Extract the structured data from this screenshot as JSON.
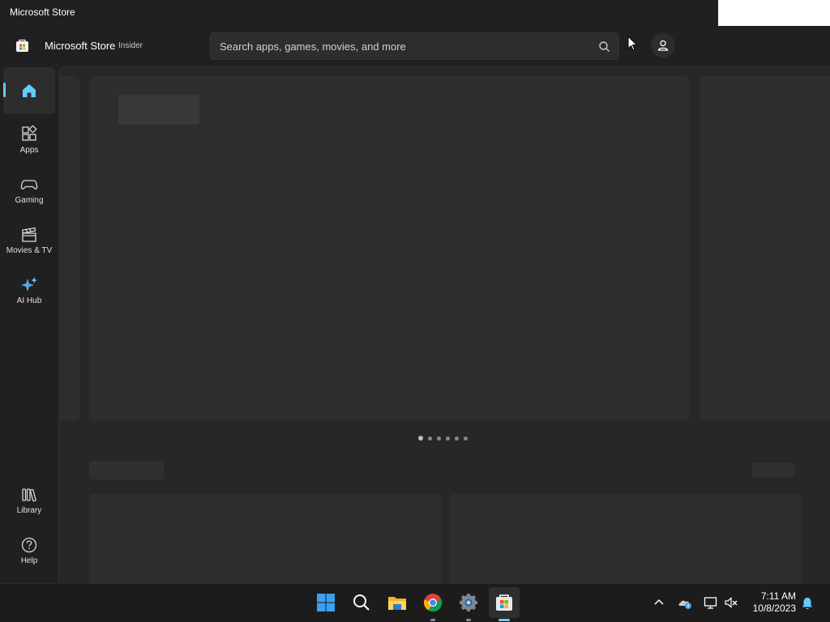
{
  "window": {
    "title": "Microsoft Store"
  },
  "header": {
    "app_name": "Microsoft Store",
    "badge": "Insider",
    "search_placeholder": "Search apps, games, movies, and more"
  },
  "sidebar": {
    "items": [
      {
        "label": "",
        "icon": "home-icon",
        "active": true
      },
      {
        "label": "Apps",
        "icon": "apps-icon"
      },
      {
        "label": "Gaming",
        "icon": "gamepad-icon"
      },
      {
        "label": "Movies & TV",
        "icon": "clapperboard-icon"
      },
      {
        "label": "AI Hub",
        "icon": "sparkle-icon"
      }
    ],
    "bottom_items": [
      {
        "label": "Library",
        "icon": "library-icon"
      },
      {
        "label": "Help",
        "icon": "help-icon"
      }
    ]
  },
  "carousel": {
    "page_count": 6,
    "active_index": 0
  },
  "taskbar": {
    "apps": [
      "windows-start-icon",
      "search-icon",
      "file-explorer-icon",
      "chrome-icon",
      "settings-icon",
      "microsoft-store-icon"
    ],
    "time": "7:11 AM",
    "date": "10/8/2023"
  },
  "colors": {
    "accent": "#60cdff",
    "background": "#202020",
    "content": "#272727"
  }
}
